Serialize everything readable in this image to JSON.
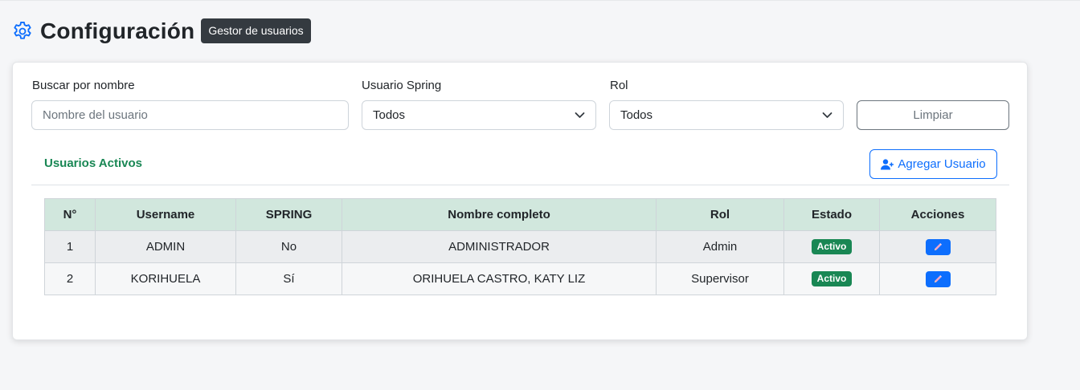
{
  "header": {
    "title": "Configuración",
    "badge": "Gestor de usuarios",
    "icon": "gear-icon"
  },
  "filters": {
    "name_label": "Buscar por nombre",
    "name_placeholder": "Nombre del usuario",
    "name_value": "",
    "spring_label": "Usuario Spring",
    "spring_value": "Todos",
    "role_label": "Rol",
    "role_value": "Todos",
    "clear_label": "Limpiar"
  },
  "section": {
    "title": "Usuarios Activos",
    "add_label": "Agregar Usuario",
    "add_icon": "user-plus-icon"
  },
  "table": {
    "columns": [
      "N°",
      "Username",
      "SPRING",
      "Nombre completo",
      "Rol",
      "Estado",
      "Acciones"
    ],
    "rows": [
      {
        "n": "1",
        "username": "ADMIN",
        "spring": "No",
        "full_name": "ADMINISTRADOR",
        "role": "Admin",
        "status": "Activo",
        "action_icon": "pencil-icon"
      },
      {
        "n": "2",
        "username": "KORIHUELA",
        "spring": "Sí",
        "full_name": "ORIHUELA CASTRO, KATY LIZ",
        "role": "Supervisor",
        "status": "Activo",
        "action_icon": "pencil-icon"
      }
    ]
  },
  "colors": {
    "accent": "#0d6efd",
    "success": "#198754",
    "header_row": "#d1e7dd",
    "badge_dark": "#343a40"
  }
}
